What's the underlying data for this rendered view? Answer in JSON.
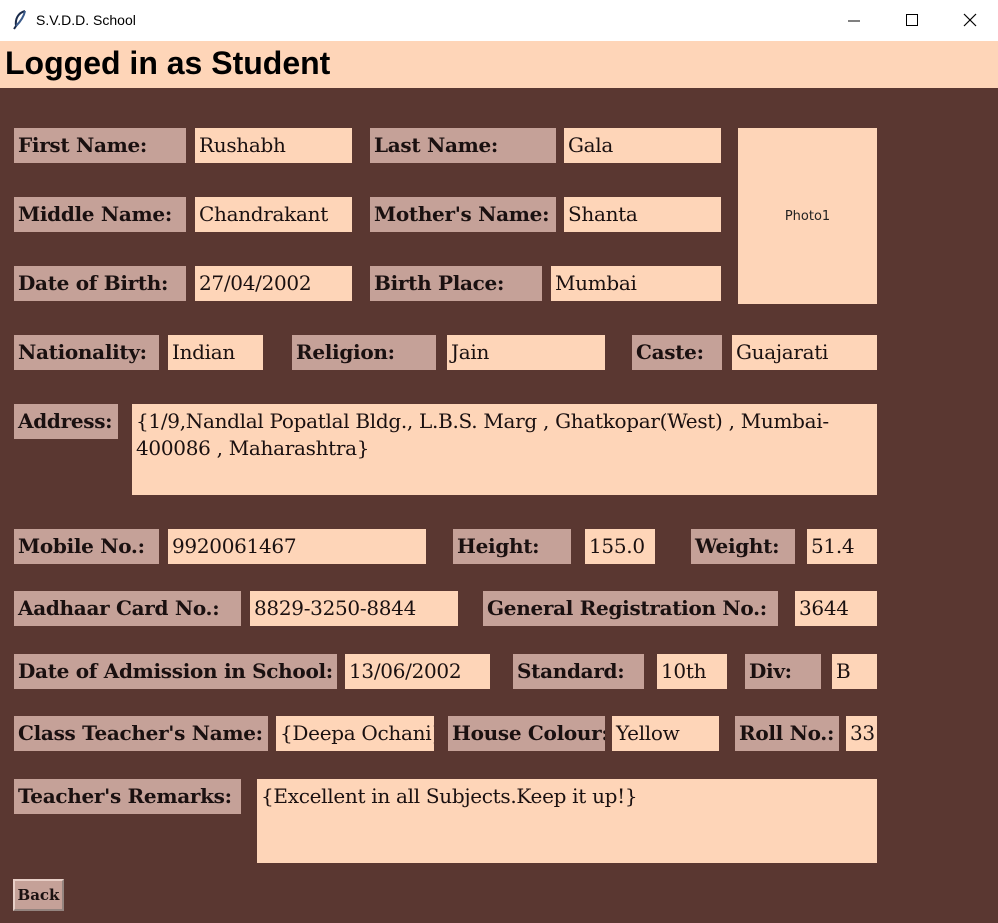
{
  "window": {
    "title": "S.V.D.D. School"
  },
  "header": {
    "title": "Logged in as Student"
  },
  "fields": {
    "first_name": {
      "label": "First Name:",
      "value": "Rushabh"
    },
    "last_name": {
      "label": "Last Name:",
      "value": "Gala"
    },
    "middle_name": {
      "label": "Middle Name:",
      "value": "Chandrakant"
    },
    "mother_name": {
      "label": "Mother's Name:",
      "value": "Shanta"
    },
    "dob": {
      "label": "Date of Birth:",
      "value": "27/04/2002"
    },
    "birth_place": {
      "label": "Birth Place:",
      "value": "Mumbai"
    },
    "nationality": {
      "label": "Nationality:",
      "value": "Indian"
    },
    "religion": {
      "label": "Religion:",
      "value": "Jain"
    },
    "caste": {
      "label": "Caste:",
      "value": "Guajarati"
    },
    "address": {
      "label": "Address:",
      "value": "{1/9,Nandlal Popatlal Bldg., L.B.S. Marg , Ghatkopar(West) , Mumbai-400086 , Maharashtra}"
    },
    "mobile": {
      "label": "Mobile No.:",
      "value": "9920061467"
    },
    "height": {
      "label": "Height:",
      "value": "155.0"
    },
    "weight": {
      "label": "Weight:",
      "value": "51.4"
    },
    "aadhaar": {
      "label": "Aadhaar Card No.:",
      "value": "8829-3250-8844"
    },
    "gr_no": {
      "label": "General Registration No.:",
      "value": "3644"
    },
    "admission_date": {
      "label": "Date of Admission in School:",
      "value": "13/06/2002"
    },
    "standard": {
      "label": "Standard:",
      "value": "10th"
    },
    "div": {
      "label": "Div:",
      "value": "B"
    },
    "class_teacher": {
      "label": "Class Teacher's Name:",
      "value": "{Deepa Ochani}"
    },
    "house_colour": {
      "label": "House Colour:",
      "value": "Yellow"
    },
    "roll_no": {
      "label": "Roll No.:",
      "value": "33"
    },
    "remarks": {
      "label": "Teacher's Remarks:",
      "value": "{Excellent in all Subjects.Keep it up!}"
    }
  },
  "photo": {
    "label": "Photo1"
  },
  "buttons": {
    "back": "Back"
  },
  "colors": {
    "background": "#5a3731",
    "header_bg": "#fed5b8",
    "label_bg": "#c5a198",
    "value_bg": "#fed5b8"
  },
  "icons": {
    "app": "feather-icon",
    "minimize": "minimize-icon",
    "maximize": "maximize-icon",
    "close": "close-icon"
  }
}
